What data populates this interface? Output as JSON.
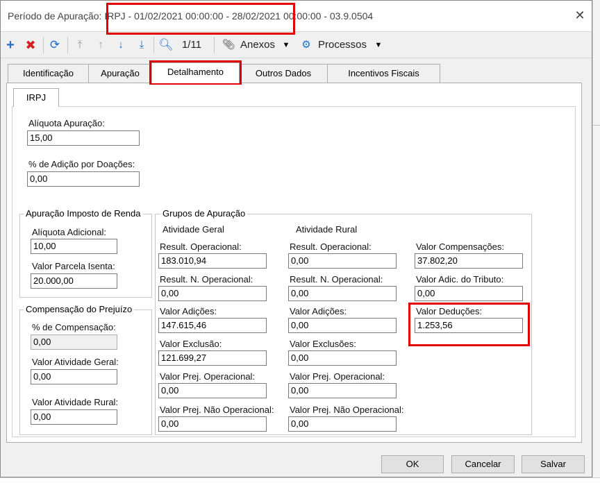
{
  "window": {
    "title": "Período de Apuração: IRPJ - 01/02/2021 00:00:00 - 28/02/2021 00:00:00 - 03.9.0504"
  },
  "toolbar": {
    "page": "1/11",
    "anexos": "Anexos",
    "processos": "Processos"
  },
  "tabs": [
    "Identificação",
    "Apuração",
    "Detalhamento",
    "Outros Dados",
    "Incentivos Fiscais"
  ],
  "active_tab": "Detalhamento",
  "inner_tab": "IRPJ",
  "aliquota_apuracao": {
    "label": "Alíquota Apuração:",
    "value": "15,00"
  },
  "adicao_doacoes": {
    "label": "% de Adição por Doações:",
    "value": "0,00"
  },
  "imposto_renda": {
    "title": "Apuração Imposto de Renda",
    "aliquota_adicional": {
      "label": "Alíquota Adicional:",
      "value": "10,00"
    },
    "parcela_isenta": {
      "label": "Valor Parcela Isenta:",
      "value": "20.000,00"
    }
  },
  "compensacao": {
    "title": "Compensação do Prejuízo",
    "percentual": {
      "label": "% de Compensação:",
      "value": "0,00"
    },
    "atividade_geral": {
      "label": "Valor Atividade Geral:",
      "value": "0,00"
    },
    "atividade_rural": {
      "label": "Valor Atividade Rural:",
      "value": "0,00"
    }
  },
  "grupos": {
    "title": "Grupos de Apuração",
    "geral": {
      "title": "Atividade Geral",
      "result_operacional": {
        "label": "Result. Operacional:",
        "value": "183.010,94"
      },
      "result_n_operacional": {
        "label": "Result. N. Operacional:",
        "value": "0,00"
      },
      "adicoes": {
        "label": "Valor Adições:",
        "value": "147.615,46"
      },
      "exclusao": {
        "label": "Valor Exclusão:",
        "value": "121.699,27"
      },
      "prej_operacional": {
        "label": "Valor Prej. Operacional:",
        "value": "0,00"
      },
      "prej_nao_operacional": {
        "label": "Valor Prej. Não Operacional:",
        "value": "0,00"
      }
    },
    "rural": {
      "title": "Atividade Rural",
      "result_operacional": {
        "label": "Result. Operacional:",
        "value": "0,00"
      },
      "result_n_operacional": {
        "label": "Result. N. Operacional:",
        "value": "0,00"
      },
      "adicoes": {
        "label": "Valor Adições:",
        "value": "0,00"
      },
      "exclusoes": {
        "label": "Valor Exclusões:",
        "value": "0,00"
      },
      "prej_operacional": {
        "label": "Valor Prej. Operacional:",
        "value": "0,00"
      },
      "prej_nao_operacional": {
        "label": "Valor Prej. Não Operacional:",
        "value": "0,00"
      }
    },
    "compensacoes": {
      "label": "Valor Compensações:",
      "value": "37.802,20"
    },
    "adic_tributo": {
      "label": "Valor Adic. do Tributo:",
      "value": "0,00"
    },
    "deducoes": {
      "label": "Valor Deduções:",
      "value": "1.253,56"
    }
  },
  "buttons": {
    "ok": "OK",
    "cancel": "Cancelar",
    "save": "Salvar"
  },
  "colors": {
    "add_icon": "#1e6fc8",
    "delete_icon": "#d02020",
    "highlight": "#e00000"
  }
}
